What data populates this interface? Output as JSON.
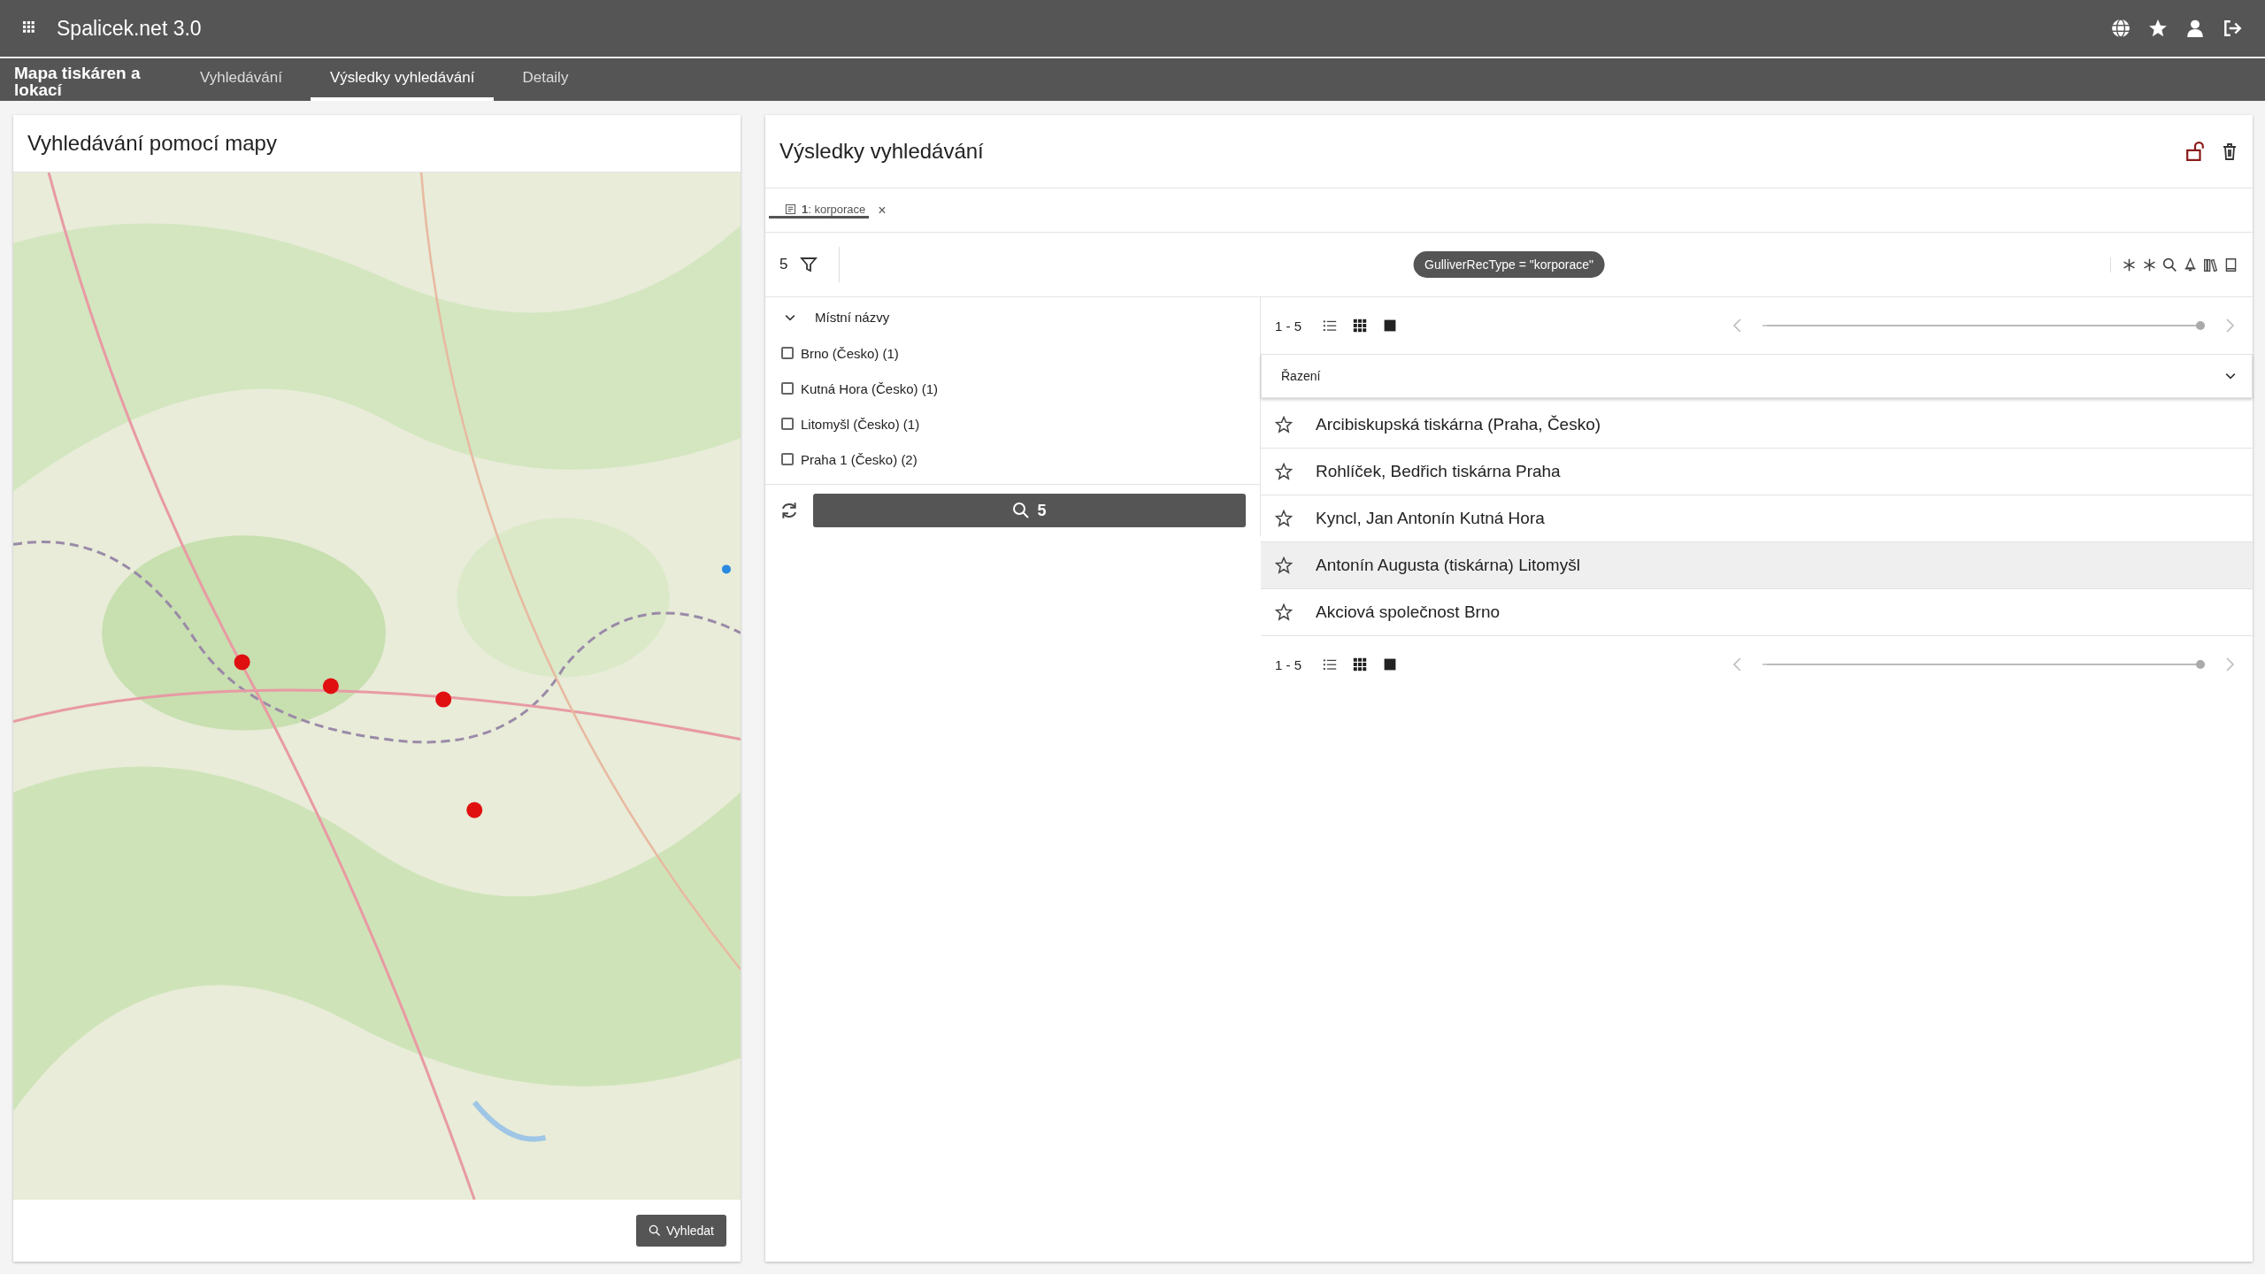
{
  "app": {
    "title": "Spalicek.net 3.0"
  },
  "nav": {
    "section": "Mapa tiskáren a lokací",
    "tabs": [
      {
        "label": "Vyhledávání",
        "selected": false
      },
      {
        "label": "Výsledky vyhledávání",
        "selected": true
      },
      {
        "label": "Detaily",
        "selected": false
      }
    ]
  },
  "map_panel": {
    "title": "Vyhledávání pomocí mapy",
    "search_button": "Vyhledat"
  },
  "results_panel": {
    "title": "Výsledky vyhledávání",
    "result_tabs": [
      {
        "number": "1",
        "label": ": korporace",
        "close": "×",
        "selected": true
      }
    ],
    "count": "5",
    "query": "GulliverRecType = \"korporace\"",
    "facet": {
      "title": "Místní názvy",
      "expanded": true,
      "items": [
        {
          "label": "Brno (Česko) (1)",
          "checked": false
        },
        {
          "label": "Kutná Hora (Česko) (1)",
          "checked": false
        },
        {
          "label": "Litomyšl (Česko) (1)",
          "checked": false
        },
        {
          "label": "Praha 1 (Česko) (2)",
          "checked": false
        }
      ]
    },
    "search_count": "5",
    "pager_top": {
      "range": "1 - 5",
      "level": 1
    },
    "sort": {
      "placeholder": "Řazení"
    },
    "results": [
      {
        "title": "Arcibiskupská tiskárna (Praha, Česko)",
        "favorite": false,
        "selected": false
      },
      {
        "title": "Rohlíček, Bedřich tiskárna Praha",
        "favorite": false,
        "selected": false
      },
      {
        "title": "Kyncl, Jan Antonín Kutná Hora",
        "favorite": false,
        "selected": false
      },
      {
        "title": "Antonín Augusta (tiskárna) Litomyšl",
        "favorite": false,
        "selected": true
      },
      {
        "title": "Akciová společnost Brno",
        "favorite": false,
        "selected": false
      }
    ],
    "pager_bottom": {
      "range": "1 - 5",
      "level": 1
    }
  }
}
